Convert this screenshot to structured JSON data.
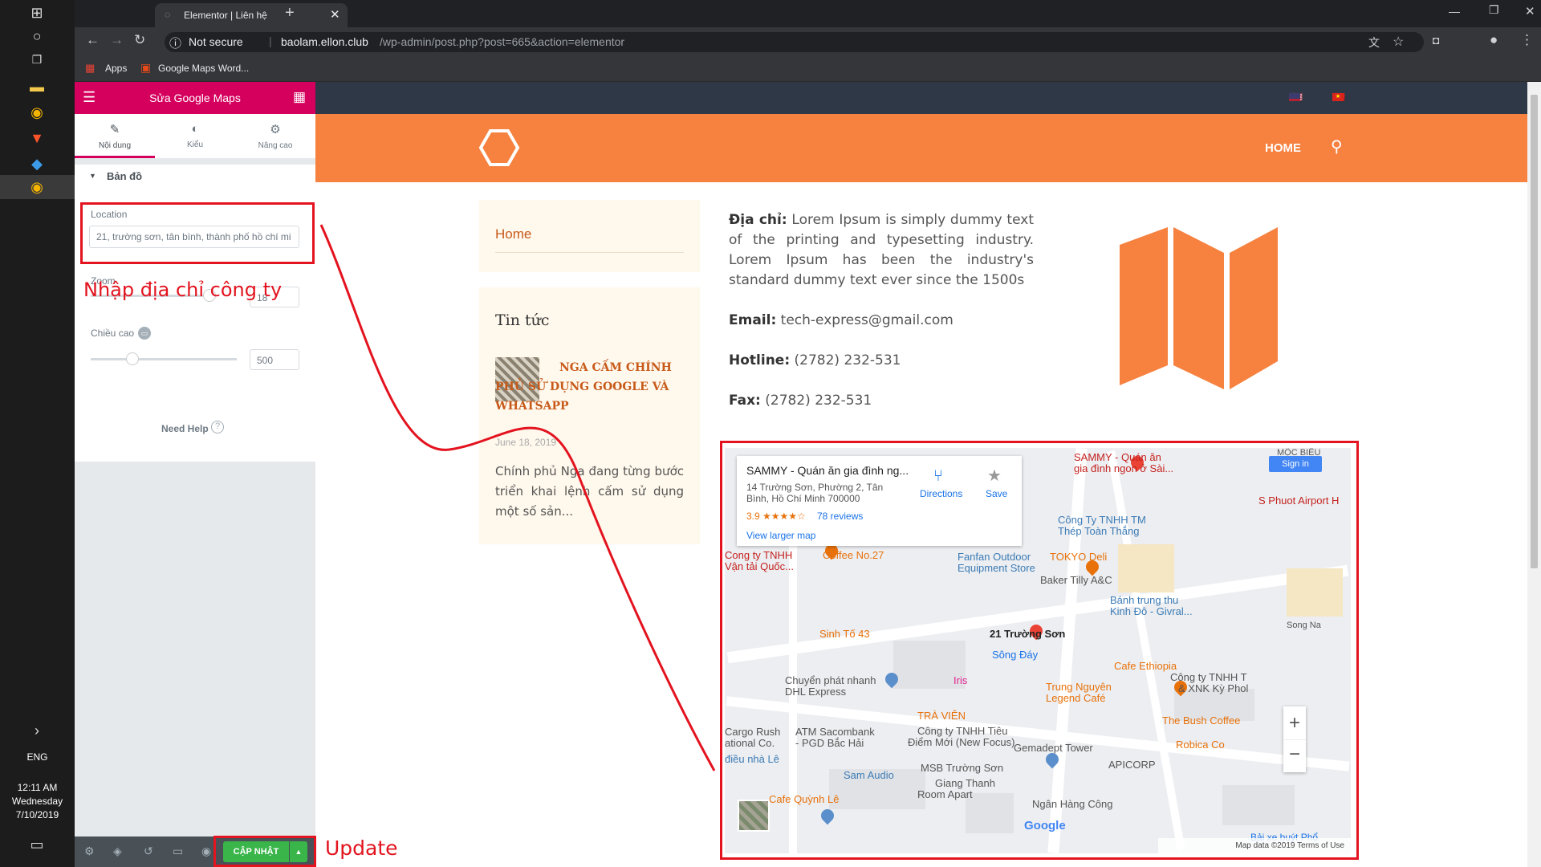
{
  "taskbar": {
    "lang": "ENG",
    "time": "12:11 AM",
    "day": "Wednesday",
    "date": "7/10/2019"
  },
  "browser": {
    "tab_title": "Elementor | Liên hệ",
    "security": "Not secure",
    "url_host": "baolam.ellon.club",
    "url_path": "/wp-admin/post.php?post=665&action=elementor",
    "bookmarks": [
      "Apps",
      "Google Maps Word..."
    ]
  },
  "panel": {
    "title": "Sửa Google Maps",
    "tabs": [
      "Nội dung",
      "Kiểu",
      "Nâng cao"
    ],
    "section": "Bản đồ",
    "location_label": "Location",
    "location_value": "21, trường sơn, tân bình, thành phố hồ chí mi",
    "zoom_label": "Zoom",
    "zoom_value": "18",
    "height_label": "Chiều cao",
    "height_value": "500",
    "need_help": "Need Help",
    "update_label": "CẬP NHẬT"
  },
  "site": {
    "nav_home": "HOME",
    "sidebar_home": "Home",
    "news_title": "Tin tức",
    "post_title": "NGA CẤM CHÍNH PHỦ SỬ DỤNG GOOGLE VÀ WHATSAPP",
    "post_date": "June 18, 2019",
    "post_excerpt": "Chính phủ Nga đang từng bước triển khai lệnh cấm sử dụng một số sản...",
    "address_label": "Địa chỉ:",
    "address_text": "Lorem Ipsum is simply dummy text of the printing and typesetting industry. Lorem Ipsum has been the industry's standard dummy text ever since the 1500s",
    "email_label": "Email:",
    "email_value": "tech-express@gmail.com",
    "hotline_label": "Hotline:",
    "hotline_value": "(2782) 232-531",
    "fax_label": "Fax:",
    "fax_value": "(2782) 232-531"
  },
  "map": {
    "place_name": "SAMMY - Quán ăn gia đình ng...",
    "place_addr": "14 Trường Sơn, Phường 2, Tân Bình, Hồ Chí Minh 700000",
    "rating": "3.9 ★★★★☆",
    "reviews": "78 reviews",
    "larger": "View larger map",
    "directions": "Directions",
    "save": "Save",
    "sign_in": "Sign in",
    "footer": "Map data ©2019   Terms of Use",
    "labels": [
      {
        "t": "SAMMY - Quán ăn",
        "c": "#c5221f"
      },
      {
        "t": "gia đình ngon ở Sài...",
        "c": "#c5221f"
      },
      {
        "t": "S Phuot Airport H",
        "c": "#c5221f"
      },
      {
        "t": "Công Ty TNHH TM",
        "c": "#3c7bb5"
      },
      {
        "t": "Thép Toàn Thắng",
        "c": "#3c7bb5"
      },
      {
        "t": "TOKYO Deli",
        "c": "#e8710a"
      },
      {
        "t": "Fanfan Outdoor",
        "c": "#3c7bb5"
      },
      {
        "t": "Equipment Store",
        "c": "#3c7bb5"
      },
      {
        "t": "Baker Tilly A&C",
        "c": "#555"
      },
      {
        "t": "Bánh trung thu",
        "c": "#3c7bb5"
      },
      {
        "t": "Kinh Đô - Givral...",
        "c": "#3c7bb5"
      },
      {
        "t": "Coffee No.27",
        "c": "#e8710a"
      },
      {
        "t": "Sinh Tố 43",
        "c": "#e8710a"
      },
      {
        "t": "21 Trường Sơn",
        "c": "#222"
      },
      {
        "t": "Sông Đáy",
        "c": "#1a73e8"
      },
      {
        "t": "Cafe Ethiopia",
        "c": "#e8710a"
      },
      {
        "t": "Chuyển phát nhanh",
        "c": "#555"
      },
      {
        "t": "DHL Express",
        "c": "#555"
      },
      {
        "t": "Trung Nguyên",
        "c": "#e8710a"
      },
      {
        "t": "Legend Café",
        "c": "#e8710a"
      },
      {
        "t": "Công ty TNHH T",
        "c": "#555"
      },
      {
        "t": "& XNK Kỳ Phol",
        "c": "#555"
      },
      {
        "t": "TRÀ VIÊN",
        "c": "#e8710a"
      },
      {
        "t": "The Bush Coffee",
        "c": "#e8710a"
      },
      {
        "t": "ATM Sacombank",
        "c": "#555"
      },
      {
        "t": "- PGD Bắc Hải",
        "c": "#555"
      },
      {
        "t": "Công ty TNHH Tiêu",
        "c": "#555"
      },
      {
        "t": "Điểm Mới (New Focus)",
        "c": "#555"
      },
      {
        "t": "Gemadept Tower",
        "c": "#555"
      },
      {
        "t": "Robica Co",
        "c": "#e8710a"
      },
      {
        "t": "APICORP",
        "c": "#555"
      },
      {
        "t": "MSB Trường Sơn",
        "c": "#555"
      },
      {
        "t": "Sam Audio",
        "c": "#3c7bb5"
      },
      {
        "t": "Giang Thanh",
        "c": "#555"
      },
      {
        "t": "Room Apart",
        "c": "#555"
      },
      {
        "t": "Cafe Quỳnh Lê",
        "c": "#e8710a"
      },
      {
        "t": "Ngân Hàng Công",
        "c": "#555"
      },
      {
        "t": "Iris",
        "c": "#e52592"
      },
      {
        "t": "Cargo Rush",
        "c": "#555"
      },
      {
        "t": "ational Co.",
        "c": "#555"
      },
      {
        "t": "điều nhà Lê",
        "c": "#3c7bb5"
      },
      {
        "t": "Cong ty TNHH",
        "c": "#c5221f"
      },
      {
        "t": "Vận tải Quốc...",
        "c": "#c5221f"
      },
      {
        "t": "Bải xe buýt Phổ",
        "c": "#1a73e8"
      },
      {
        "t": "Song Na",
        "c": "#555"
      },
      {
        "t": "MỘC BIÊU",
        "c": "#555"
      }
    ]
  },
  "annotations": {
    "address_note": "Nhập địa chỉ công ty",
    "update_note": "Update"
  },
  "colors": {
    "elementor": "#d5005d",
    "header": "#f7813f",
    "accent": "#c75a1a",
    "annotation": "#e3131f"
  }
}
